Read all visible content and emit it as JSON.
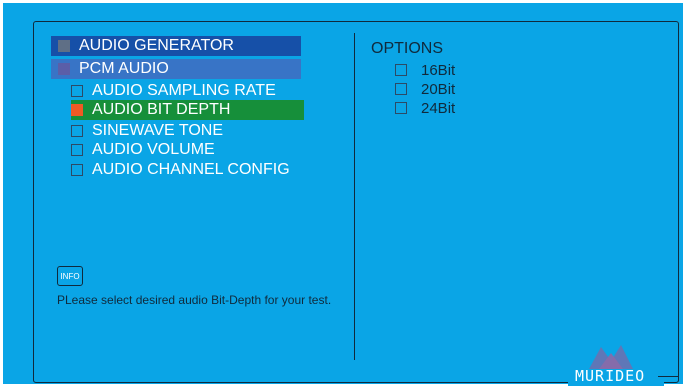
{
  "menu": {
    "header_audio_generator": "AUDIO GENERATOR",
    "header_pcm_audio": "PCM AUDIO",
    "items": [
      {
        "label": "AUDIO SAMPLING RATE",
        "selected": false
      },
      {
        "label": "AUDIO BIT DEPTH",
        "selected": true
      },
      {
        "label": "SINEWAVE TONE",
        "selected": false
      },
      {
        "label": "AUDIO VOLUME",
        "selected": false
      },
      {
        "label": "AUDIO CHANNEL CONFIG",
        "selected": false
      }
    ]
  },
  "options": {
    "title": "OPTIONS",
    "items": [
      {
        "label": "16Bit",
        "checked": false
      },
      {
        "label": "20Bit",
        "checked": false
      },
      {
        "label": "24Bit",
        "checked": false
      }
    ]
  },
  "info": {
    "button_label": "INFO",
    "text": "PLease select desired audio Bit-Depth for your test."
  },
  "brand": {
    "name": "MURIDEO",
    "logo_icon": "murideo-mountain-icon"
  },
  "colors": {
    "background": "#0aa5e6",
    "header_primary": "#1650a8",
    "header_secondary": "#3874c6",
    "selected_row": "#168f3a",
    "active_marker": "#f05a24"
  }
}
